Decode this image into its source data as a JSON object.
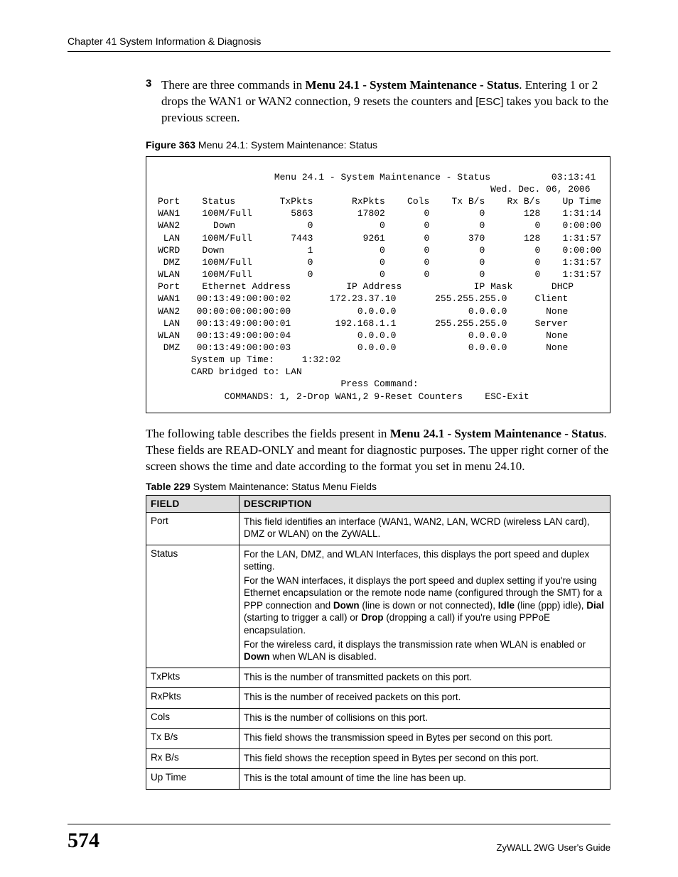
{
  "header": {
    "running": "Chapter 41 System Information & Diagnosis"
  },
  "step": {
    "num": "3",
    "pre": "There are three commands in ",
    "bold1": "Menu 24.1 - System Maintenance - Status",
    "mid1": ". Entering 1 or 2 drops the WAN1 or WAN2 connection, 9 resets the counters and ",
    "esc": "[ESC]",
    "mid2": " takes you back to the previous screen."
  },
  "figure": {
    "label": "Figure 363",
    "title": "   Menu 24.1: System Maintenance: Status"
  },
  "terminal": {
    "title": "                     Menu 24.1 - System Maintenance - Status           03:13:41",
    "date": "                                                            Wed. Dec. 06, 2006",
    "hdr1": "Port    Status        TxPkts       RxPkts    Cols    Tx B/s    Rx B/s    Up Time",
    "r1": "WAN1    100M/Full       5863        17802       0         0       128    1:31:14",
    "r2": "WAN2      Down             0            0       0         0         0    0:00:00",
    "r3": " LAN    100M/Full       7443         9261       0       370       128    1:31:57",
    "r4": "WCRD    Down               1            0       0         0         0    0:00:00",
    "r5": " DMZ    100M/Full          0            0       0         0         0    1:31:57",
    "r6": "WLAN    100M/Full          0            0       0         0         0    1:31:57",
    "blank1": "",
    "hdr2": "Port    Ethernet Address          IP Address             IP Mask       DHCP",
    "a1": "WAN1   00:13:49:00:00:02       172.23.37.10       255.255.255.0     Client",
    "a2": "WAN2   00:00:00:00:00:00            0.0.0.0             0.0.0.0       None",
    "a3": " LAN   00:13:49:00:00:01        192.168.1.1       255.255.255.0     Server",
    "a4": "WLAN   00:13:49:00:00:04            0.0.0.0             0.0.0.0       None",
    "a5": " DMZ   00:13:49:00:00:03            0.0.0.0             0.0.0.0       None",
    "blank2": "",
    "up": "      System up Time:     1:32:02",
    "bridge": "      CARD bridged to: LAN",
    "press": "                                 Press Command:",
    "blank3": "",
    "cmds": "            COMMANDS: 1, 2-Drop WAN1,2 9-Reset Counters    ESC-Exit"
  },
  "after_fig": {
    "pre": "The following table describes the fields present in ",
    "bold": "Menu 24.1 - System Maintenance - Status",
    "post": ". These fields are READ-ONLY and meant for diagnostic purposes. The upper right corner of the screen shows the time and date according to the format you set in menu 24.10."
  },
  "table_caption": {
    "label": "Table 229",
    "title": "   System Maintenance: Status Menu Fields"
  },
  "table_head": {
    "c1": "FIELD",
    "c2": "DESCRIPTION"
  },
  "rows": [
    {
      "field": "Port",
      "desc": [
        {
          "t": "This field identifies an interface (WAN1, WAN2, LAN, WCRD (wireless LAN card), DMZ or WLAN) on the ZyWALL."
        }
      ]
    },
    {
      "field": "Status",
      "desc": [
        {
          "t": "For the LAN, DMZ, and WLAN Interfaces, this displays the port speed and duplex setting."
        },
        {
          "rich": true,
          "parts": [
            {
              "t": "For the WAN interfaces, it displays the port speed and duplex setting if you're using Ethernet encapsulation or the remote node name (configured through the SMT) for a PPP connection and "
            },
            {
              "b": "Down"
            },
            {
              "t": " (line is down or not connected), "
            },
            {
              "b": "Idle"
            },
            {
              "t": " (line (ppp) idle), "
            },
            {
              "b": "Dial"
            },
            {
              "t": " (starting to trigger a call) or "
            },
            {
              "b": "Drop"
            },
            {
              "t": " (dropping a call) if you're using PPPoE encapsulation."
            }
          ]
        },
        {
          "rich": true,
          "parts": [
            {
              "t": "For the wireless card, it displays the transmission rate when WLAN is enabled or "
            },
            {
              "b": "Down"
            },
            {
              "t": " when WLAN is disabled."
            }
          ]
        }
      ]
    },
    {
      "field": "TxPkts",
      "desc": [
        {
          "t": "This is the number of transmitted packets on this port."
        }
      ]
    },
    {
      "field": "RxPkts",
      "desc": [
        {
          "t": "This is the number of received packets on this port."
        }
      ]
    },
    {
      "field": "Cols",
      "desc": [
        {
          "t": "This is the number of collisions on this port."
        }
      ]
    },
    {
      "field": "Tx B/s",
      "desc": [
        {
          "t": "This field shows the transmission speed in Bytes per second on this port."
        }
      ]
    },
    {
      "field": "Rx B/s",
      "desc": [
        {
          "t": "This field shows the reception speed in Bytes per second on this port."
        }
      ]
    },
    {
      "field": "Up Time",
      "desc": [
        {
          "t": "This is the total amount of time the line has been up."
        }
      ]
    }
  ],
  "footer": {
    "page": "574",
    "guide": "ZyWALL 2WG User's Guide"
  }
}
